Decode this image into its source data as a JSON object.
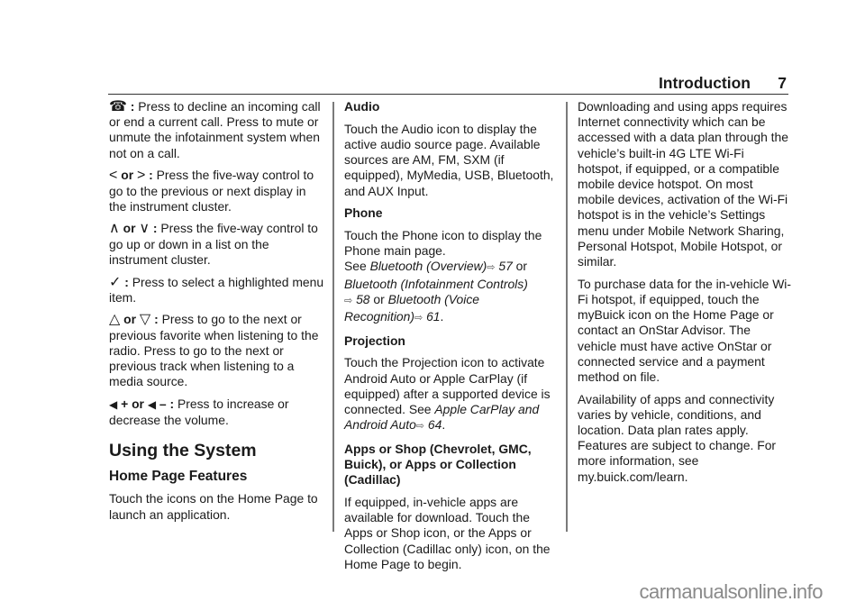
{
  "header": {
    "title": "Introduction",
    "page_number": "7"
  },
  "column1": {
    "items": [
      {
        "icon": "end-call-icon",
        "glyph": "☎",
        "sep": " : ",
        "text": "Press to decline an incoming call or end a current call. Press to mute or unmute the infotainment system when not on a call."
      },
      {
        "icon_a": "chevron-left-icon",
        "glyph_a": "<",
        "or": " or ",
        "icon_b": "chevron-right-icon",
        "glyph_b": ">",
        "sep": " : ",
        "text": "Press the five-way control to go to the previous or next display in the instrument cluster."
      },
      {
        "icon_a": "chevron-up-icon",
        "glyph_a": "∧",
        "or": " or ",
        "icon_b": "chevron-down-icon",
        "glyph_b": "∨",
        "sep": " : ",
        "text": "Press the five-way control to go up or down in a list on the instrument cluster."
      },
      {
        "icon": "checkmark-icon",
        "glyph": "✓",
        "sep": " : ",
        "text": "Press to select a highlighted menu item."
      },
      {
        "icon_a": "next-favorite-icon",
        "glyph_a": "△",
        "or": " or ",
        "icon_b": "previous-favorite-icon",
        "glyph_b": "▽",
        "sep": " : ",
        "text": "Press to go to the next or previous favorite when listening to the radio. Press to go to the next or previous track when listening to a media source."
      },
      {
        "icon_a": "volume-up-icon",
        "glyph_a": "◀",
        "suffix_a": " + or ",
        "icon_b": "volume-down-icon",
        "glyph_b": "◀",
        "suffix_b": " – : ",
        "text": "Press to increase or decrease the volume."
      }
    ],
    "section_title": "Using the System",
    "subsection_title": "Home Page Features",
    "subsection_text": "Touch the icons on the Home Page to launch an application."
  },
  "column2": {
    "audio": {
      "heading": "Audio",
      "text": "Touch the Audio icon to display the active audio source page. Available sources are AM, FM, SXM (if equipped), MyMedia, USB, Bluetooth, and AUX Input."
    },
    "phone": {
      "heading": "Phone",
      "text_1": "Touch the Phone icon to display the Phone main page.",
      "see": "See ",
      "ref_1": "Bluetooth (Overview)",
      "page_1": " 57",
      "or_1": " or ",
      "ref_2": "Bluetooth (Infotainment Controls)",
      "page_2": " 58",
      "or_2": " or ",
      "ref_3": "Bluetooth (Voice Recognition)",
      "page_3": " 61",
      "end": ".",
      "arrow_glyph": "⇨"
    },
    "projection": {
      "heading": "Projection",
      "text": "Touch the Projection icon to activate Android Auto or Apple CarPlay (if equipped) after a supported device is connected. See ",
      "ref": "Apple CarPlay and Android Auto",
      "page": " 64",
      "end": "."
    },
    "apps": {
      "heading": "Apps or Shop (Chevrolet, GMC, Buick), or Apps or Collection (Cadillac)",
      "text": "If equipped, in-vehicle apps are available for download. Touch the Apps or Shop icon, or the Apps or Collection (Cadillac only) icon, on the Home Page to begin."
    }
  },
  "column3": {
    "paragraphs": [
      "Downloading and using apps requires Internet connectivity which can be accessed with a data plan through the vehicle’s built-in 4G LTE Wi-Fi hotspot, if equipped, or a compatible mobile device hotspot. On most mobile devices, activation of the Wi-Fi hotspot is in the vehicle’s Settings menu under Mobile Network Sharing, Personal Hotspot, Mobile Hotspot, or similar.",
      "To purchase data for the in-vehicle Wi-Fi hotspot, if equipped, touch the myBuick icon on the Home Page or contact an OnStar Advisor. The vehicle must have active OnStar or connected service and a payment method on file.",
      "Availability of apps and connectivity varies by vehicle, conditions, and location. Data plan rates apply. Features are subject to change. For more information, see my.buick.com/learn."
    ]
  },
  "watermark": "carmanualsonline.info"
}
